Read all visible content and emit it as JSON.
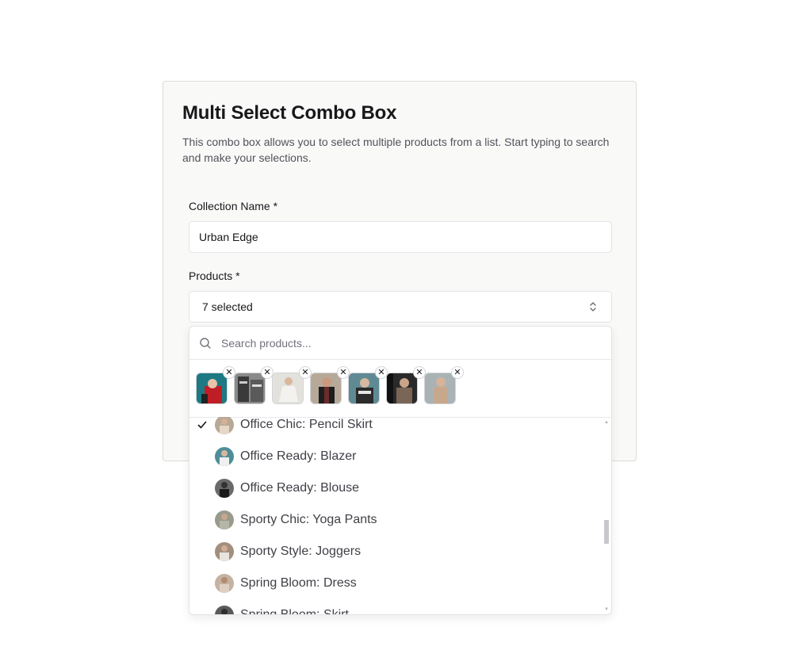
{
  "card": {
    "title": "Multi Select Combo Box",
    "description": "This combo box allows you to select multiple products from a list. Start typing to search and make your selections."
  },
  "collection": {
    "label": "Collection Name *",
    "value": "Urban Edge"
  },
  "products": {
    "label": "Products *",
    "trigger_text": "7 selected",
    "trigger_icon": "chevrons-up-down-icon",
    "search_placeholder": "Search products...",
    "search_icon": "search-icon",
    "selected_count": 7,
    "remove_glyph": "✕",
    "options": [
      {
        "label": "Office Chic: Pencil Skirt",
        "selected": true
      },
      {
        "label": "Office Ready: Blazer",
        "selected": false
      },
      {
        "label": "Office Ready: Blouse",
        "selected": false
      },
      {
        "label": "Sporty Chic: Yoga Pants",
        "selected": false
      },
      {
        "label": "Sporty Style: Joggers",
        "selected": false
      },
      {
        "label": "Spring Bloom: Dress",
        "selected": false
      },
      {
        "label": "Spring Bloom: Skirt",
        "selected": false
      }
    ]
  },
  "colors": {
    "card_bg": "#f9f9f8",
    "border": "#e4e4e7",
    "text": "#18181b",
    "muted": "#52525b"
  }
}
